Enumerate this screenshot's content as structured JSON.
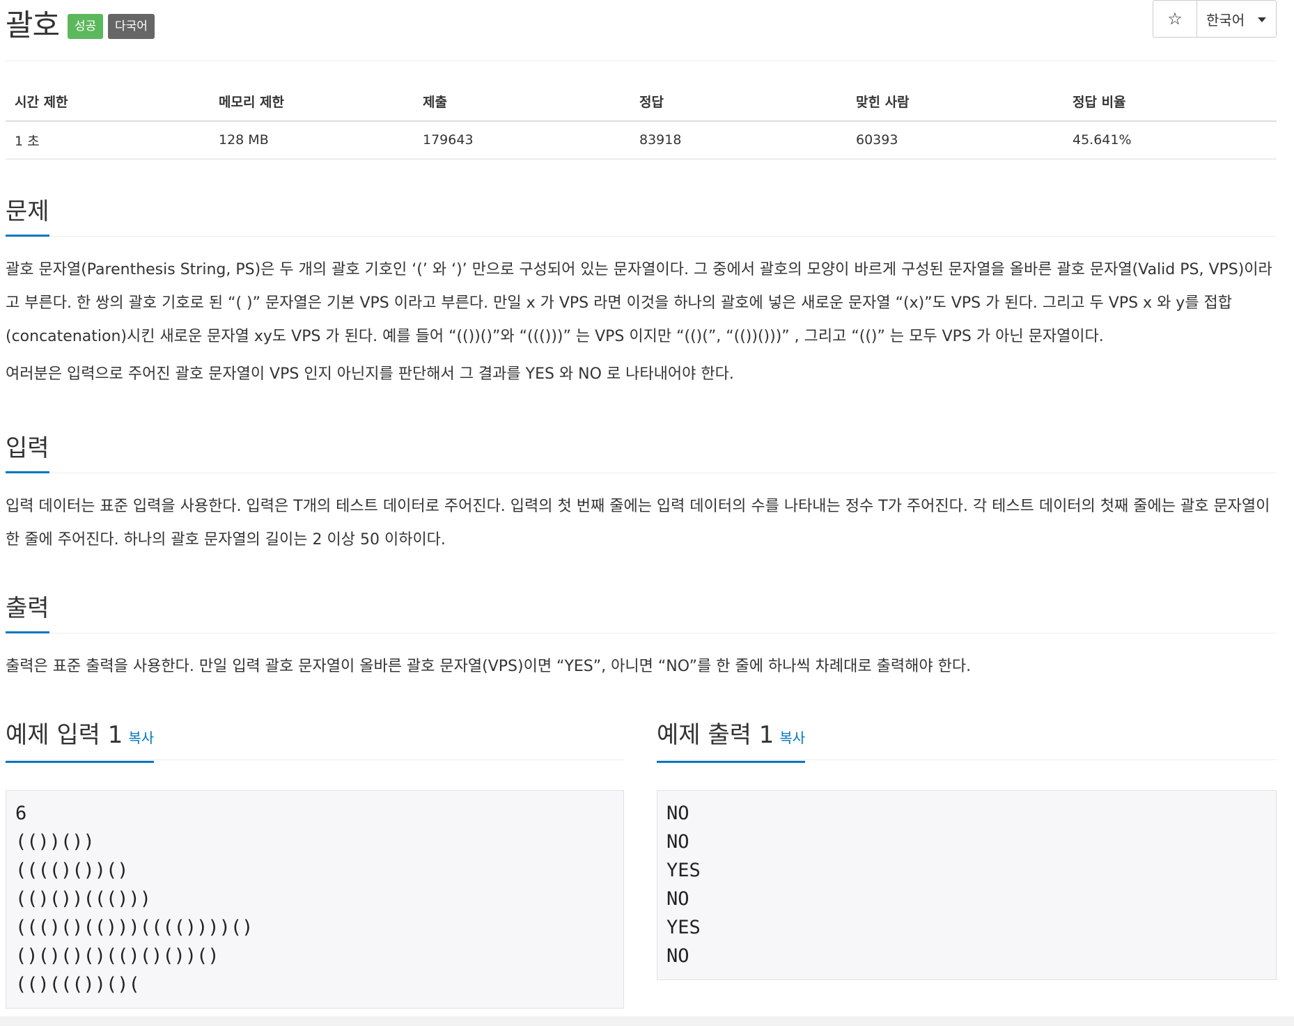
{
  "header": {
    "title": "괄호",
    "badges": [
      "성공",
      "다국어"
    ],
    "star_icon": "star-icon",
    "language": "한국어"
  },
  "info": {
    "headers": [
      "시간 제한",
      "메모리 제한",
      "제출",
      "정답",
      "맞힌 사람",
      "정답 비율"
    ],
    "values": [
      "1 초",
      "128 MB",
      "179643",
      "83918",
      "60393",
      "45.641%"
    ]
  },
  "problem": {
    "title": "문제",
    "p1": "괄호 문자열(Parenthesis String, PS)은 두 개의 괄호 기호인 ‘(’ 와 ‘)’ 만으로 구성되어 있는 문자열이다. 그 중에서 괄호의 모양이 바르게 구성된 문자열을 올바른 괄호 문자열(Valid PS, VPS)이라고 부른다. 한 쌍의 괄호 기호로 된 “( )” 문자열은 기본 VPS 이라고 부른다. 만일 x 가 VPS 라면 이것을 하나의 괄호에 넣은 새로운 문자열 “(x)”도 VPS 가 된다. 그리고 두 VPS x 와 y를 접합(concatenation)시킨 새로운 문자열 xy도 VPS 가 된다. 예를 들어 “(())()”와 “((()))” 는 VPS 이지만 “(()(”, “(())()))” , 그리고 “(()” 는 모두 VPS 가 아닌 문자열이다.",
    "p2": "여러분은 입력으로 주어진 괄호 문자열이 VPS 인지 아닌지를 판단해서 그 결과를 YES 와 NO 로 나타내어야 한다."
  },
  "input": {
    "title": "입력",
    "p1": "입력 데이터는 표준 입력을 사용한다. 입력은 T개의 테스트 데이터로 주어진다. 입력의 첫 번째 줄에는 입력 데이터의 수를 나타내는 정수 T가 주어진다. 각 테스트 데이터의 첫째 줄에는 괄호 문자열이 한 줄에 주어진다. 하나의 괄호 문자열의 길이는 2 이상 50 이하이다."
  },
  "output": {
    "title": "출력",
    "p1": "출력은 표준 출력을 사용한다. 만일 입력 괄호 문자열이 올바른 괄호 문자열(VPS)이면 “YES”, 아니면 “NO”를 한 줄에 하나씩 차례대로 출력해야 한다."
  },
  "sample_input": {
    "title": "예제 입력 1",
    "copy_label": "복사",
    "lines": [
      "6",
      "(())())",
      "(((()())()",
      "(()())((()))",
      "((()()(()))(((())))()",
      "()()()()(()()())()",
      "(()((())()("
    ]
  },
  "sample_output": {
    "title": "예제 출력 1",
    "copy_label": "복사",
    "lines": [
      "NO",
      "NO",
      "YES",
      "NO",
      "YES",
      "NO"
    ]
  }
}
